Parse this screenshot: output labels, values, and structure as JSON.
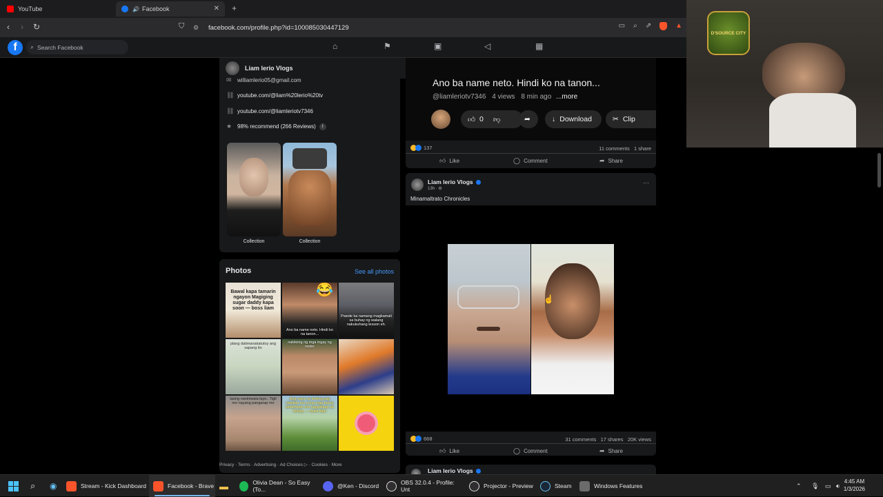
{
  "browser": {
    "tabs": [
      {
        "label": "YouTube",
        "color": "#ff0000"
      },
      {
        "label": "Facebook",
        "color": "#1877f2"
      }
    ],
    "url": "facebook.com/profile.php?id=100085030447129"
  },
  "facebook": {
    "search_placeholder": "Search Facebook",
    "profile_name": "Liam lerio Vlogs",
    "intro": {
      "email": "williamlerio05@gmail.com",
      "links": [
        "youtube.com/@liam%20lerio%20tv",
        "youtube.com/@liamleriotv7346"
      ],
      "recommend": "98% recommend (266 Reviews)"
    },
    "collections": [
      "Collection",
      "Collection"
    ],
    "photos": {
      "title": "Photos",
      "see_all": "See all photos",
      "captions": [
        "Bawal kapa tamarin ngayon Magiging sugar daddy kapa soon — boss liam",
        "Ano ba name neto. Hindi ko na tanon...",
        "Pwede ka namang magkamali sa buhay ng walang nakukuhang lesson eh.",
        "plang datimanakatutoy ang sapang ito",
        "nakikinig ng mga ingay ng motor",
        "",
        "taong naniniwala layo.. Tigil mo nayang pangarap mo",
        "Ang saya sa feeling pag nakikita mo yung mga taong kinaiinisan mo nagsisikap sa buhay. — boss liam",
        ""
      ]
    },
    "footer": "Privacy · Terms · Advertising · Ad Choices ▷ · Cookies · More"
  },
  "post1": {
    "video_title": "Ano ba name neto. Hindi ko na tanon...",
    "channel": "@liamleriotv7346",
    "views": "4 views",
    "time": "8 min ago",
    "more": "...more",
    "likes": "0",
    "download": "Download",
    "clip": "Clip",
    "reactions": "137",
    "comments": "11 comments",
    "shares": "1 share"
  },
  "post2": {
    "author": "Liam lerio Vlogs",
    "time": "13h · ⚙",
    "text": "Minamaltrato Chronicles",
    "reactions": "668",
    "comments": "31 comments",
    "shares": "17 shares",
    "views": "20K views"
  },
  "post3": {
    "author": "Liam lerio Vlogs"
  },
  "actions": {
    "like": "Like",
    "comment": "Comment",
    "share": "Share"
  },
  "overlay": {
    "logo_text": "D'SOURCE CITY"
  },
  "taskbar": {
    "items": [
      {
        "label": "Stream - Kick Dashboard",
        "color": "#fb542b"
      },
      {
        "label": "Facebook - Brave",
        "color": "#fb542b"
      },
      {
        "label": "Olivia Dean - So Easy (To...",
        "color": "#1db954"
      },
      {
        "label": "@Ken - Discord",
        "color": "#5865f2"
      },
      {
        "label": "OBS 32.0.4 - Profile: Unt",
        "color": "#302e31"
      },
      {
        "label": "Projector - Preview",
        "color": "#302e31"
      },
      {
        "label": "Steam",
        "color": "#1b2838"
      },
      {
        "label": "Windows Features",
        "color": "#6b6b6b"
      }
    ],
    "time": "4:45 AM",
    "date": "1/3/2026"
  }
}
